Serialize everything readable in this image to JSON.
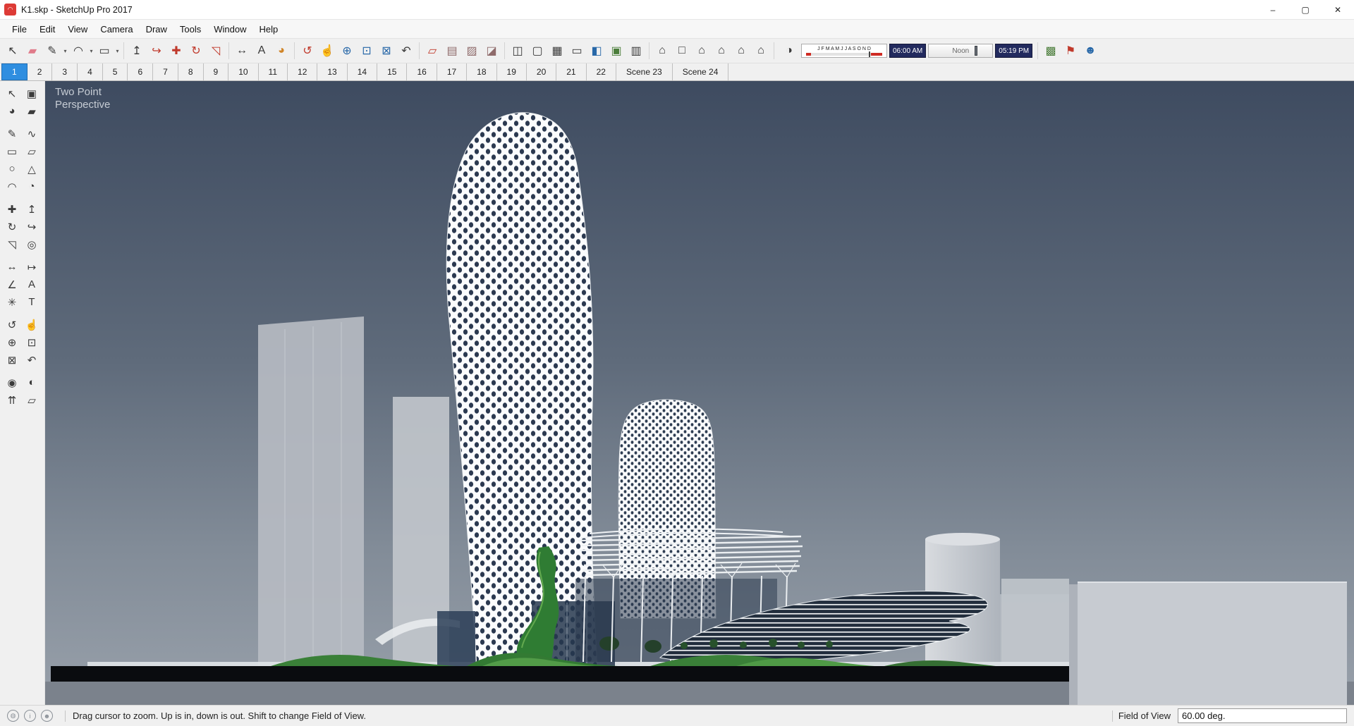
{
  "window": {
    "title": "K1.skp - SketchUp Pro 2017",
    "logo_glyph": "◠",
    "controls": {
      "minimize": "–",
      "maximize": "▢",
      "close": "✕"
    }
  },
  "menu_bar": {
    "items": [
      "File",
      "Edit",
      "View",
      "Camera",
      "Draw",
      "Tools",
      "Window",
      "Help"
    ]
  },
  "top_toolbar": {
    "dropdown_glyph": "▾",
    "icons": [
      {
        "name": "select-tool",
        "glyph": "↖"
      },
      {
        "name": "eraser-tool",
        "glyph": "▰"
      },
      {
        "name": "line-tool",
        "glyph": "✎"
      },
      {
        "name": "arc-tool",
        "glyph": "◠"
      },
      {
        "name": "shapes-tool",
        "glyph": "▭"
      },
      {
        "name": "push-pull-tool",
        "glyph": "↥"
      },
      {
        "name": "follow-me-tool",
        "glyph": "↪"
      },
      {
        "name": "move-tool",
        "glyph": "✚"
      },
      {
        "name": "rotate-tool",
        "glyph": "↻"
      },
      {
        "name": "scale-tool",
        "glyph": "◹"
      },
      {
        "name": "tape-measure-tool",
        "glyph": "↔"
      },
      {
        "name": "text-tool",
        "glyph": "A"
      },
      {
        "name": "paint-bucket-tool",
        "glyph": "◕"
      },
      {
        "name": "orbit-tool",
        "glyph": "↺"
      },
      {
        "name": "pan-tool",
        "glyph": "☝"
      },
      {
        "name": "zoom-tool",
        "glyph": "⊕"
      },
      {
        "name": "zoom-window-tool",
        "glyph": "⊡"
      },
      {
        "name": "zoom-extents-tool",
        "glyph": "⊠"
      },
      {
        "name": "previous-view-tool",
        "glyph": "↶"
      },
      {
        "name": "section-plane-tool",
        "glyph": "▱"
      },
      {
        "name": "display-section-cuts-toggle",
        "glyph": "▤"
      },
      {
        "name": "display-section-planes-toggle",
        "glyph": "▨"
      },
      {
        "name": "section-fill-toggle",
        "glyph": "◪"
      },
      {
        "name": "back-edges-toggle",
        "glyph": "◫"
      },
      {
        "name": "xray-mode",
        "glyph": "▢"
      },
      {
        "name": "wireframe-mode",
        "glyph": "▦"
      },
      {
        "name": "hidden-line-mode",
        "glyph": "▭"
      },
      {
        "name": "shaded-mode",
        "glyph": "◧"
      },
      {
        "name": "shaded-textures-mode",
        "glyph": "▣"
      },
      {
        "name": "monochrome-mode",
        "glyph": "▥"
      },
      {
        "name": "iso-view",
        "glyph": "⌂"
      },
      {
        "name": "top-view",
        "glyph": "□"
      },
      {
        "name": "front-view",
        "glyph": "⌂"
      },
      {
        "name": "right-view",
        "glyph": "⌂"
      },
      {
        "name": "back-view",
        "glyph": "⌂"
      },
      {
        "name": "left-view",
        "glyph": "⌂"
      },
      {
        "name": "photo-texture-icon",
        "glyph": "▩"
      },
      {
        "name": "flag-icon",
        "glyph": "⚑"
      },
      {
        "name": "account-icon",
        "glyph": "☻"
      }
    ],
    "shadows": {
      "settings_glyph": "◑",
      "months": "J F M A M J J A S O N D",
      "time_start": "06:00 AM",
      "time_mid": "Noon",
      "time_end": "05:19 PM"
    }
  },
  "scene_tabs": {
    "active_tab": "1",
    "tabs": [
      "1",
      "2",
      "3",
      "4",
      "5",
      "6",
      "7",
      "8",
      "9",
      "10",
      "11",
      "12",
      "13",
      "14",
      "15",
      "16",
      "17",
      "18",
      "19",
      "20",
      "21",
      "22",
      "Scene 23",
      "Scene 24"
    ]
  },
  "tool_palette": {
    "icons": [
      {
        "name": "select-tool",
        "glyph": "↖"
      },
      {
        "name": "make-component-tool",
        "glyph": "▣"
      },
      {
        "name": "paint-bucket-tool",
        "glyph": "◕"
      },
      {
        "name": "eraser-tool",
        "glyph": "▰"
      },
      {
        "name": "line-tool",
        "glyph": "✎"
      },
      {
        "name": "freehand-tool",
        "glyph": "∿"
      },
      {
        "name": "rectangle-tool",
        "glyph": "▭"
      },
      {
        "name": "rotated-rectangle-tool",
        "glyph": "▱"
      },
      {
        "name": "circle-tool",
        "glyph": "○"
      },
      {
        "name": "polygon-tool",
        "glyph": "△"
      },
      {
        "name": "arc-tool",
        "glyph": "◠"
      },
      {
        "name": "pie-tool",
        "glyph": "◔"
      },
      {
        "name": "move-tool",
        "glyph": "✚"
      },
      {
        "name": "push-pull-tool",
        "glyph": "↥"
      },
      {
        "name": "rotate-tool",
        "glyph": "↻"
      },
      {
        "name": "follow-me-tool",
        "glyph": "↪"
      },
      {
        "name": "scale-tool",
        "glyph": "◹"
      },
      {
        "name": "offset-tool",
        "glyph": "◎"
      },
      {
        "name": "tape-measure-tool",
        "glyph": "↔"
      },
      {
        "name": "dimension-tool",
        "glyph": "↦"
      },
      {
        "name": "protractor-tool",
        "glyph": "∠"
      },
      {
        "name": "text-tool",
        "glyph": "A"
      },
      {
        "name": "axes-tool",
        "glyph": "✳"
      },
      {
        "name": "3d-text-tool",
        "glyph": "T"
      },
      {
        "name": "orbit-tool",
        "glyph": "↺"
      },
      {
        "name": "pan-tool",
        "glyph": "☝"
      },
      {
        "name": "zoom-tool",
        "glyph": "⊕"
      },
      {
        "name": "zoom-window-tool",
        "glyph": "⊡"
      },
      {
        "name": "zoom-extents-tool",
        "glyph": "⊠"
      },
      {
        "name": "previous-view-tool",
        "glyph": "↶"
      },
      {
        "name": "position-camera-tool",
        "glyph": "◉"
      },
      {
        "name": "look-around-tool",
        "glyph": "◐"
      },
      {
        "name": "walk-tool",
        "glyph": "⇈"
      },
      {
        "name": "section-plane-tool",
        "glyph": "▱"
      }
    ]
  },
  "viewport": {
    "camera_line1": "Two Point",
    "camera_line2": "Perspective"
  },
  "status_bar": {
    "icons": [
      {
        "name": "geolocation-icon",
        "glyph": "◍"
      },
      {
        "name": "credits-icon",
        "glyph": "i"
      },
      {
        "name": "signin-icon",
        "glyph": "☻"
      }
    ],
    "hint": "Drag cursor to zoom.  Up is in, down is out. Shift to change Field of View.",
    "measure_label": "Field of View",
    "measure_value": "60.00 deg."
  },
  "colors": {
    "active_tab_blue": "#2f8ee0",
    "sky_top": "#3e4b60",
    "sky_bottom": "#98a0aa",
    "shadow_timebox_navy": "#222a5e",
    "logo_red": "#dd3b36",
    "facade_dark": "#2b3950",
    "landscape_green": "#3a8038"
  }
}
